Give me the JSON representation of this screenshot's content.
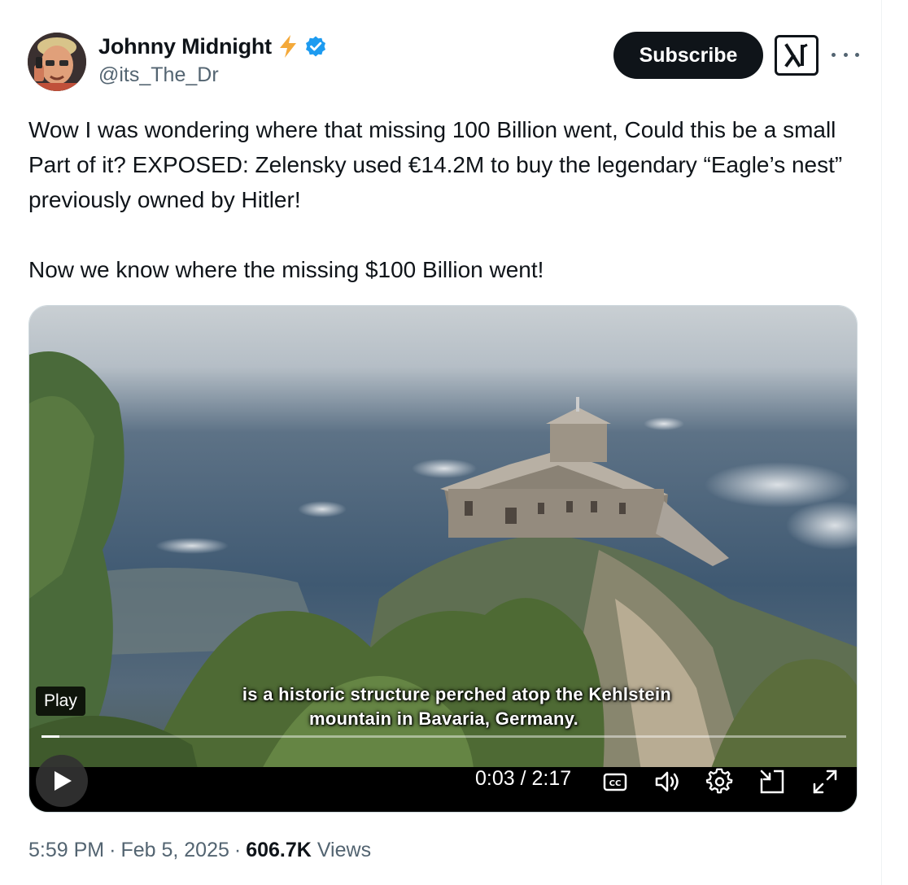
{
  "author": {
    "display_name": "Johnny Midnight",
    "handle": "@its_The_Dr",
    "badge_icons": [
      "lightning-bolt-icon",
      "verified-badge-icon"
    ],
    "badge_colors": {
      "bolt": "#f4a93a",
      "verified": "#1d9bf0"
    }
  },
  "actions": {
    "subscribe_label": "Subscribe",
    "grok_icon": "grok-icon",
    "more_icon": "more-dots-icon"
  },
  "tweet": {
    "paragraph_1": "Wow I was wondering where that missing 100 Billion went, Could this be a small Part of it? EXPOSED: Zelensky used €14.2M to buy the legendary “Eagle’s nest” previously owned by Hitler!",
    "paragraph_2": "Now we know where the missing $100 Billion went!"
  },
  "video": {
    "play_tooltip": "Play",
    "subtitle_line_1": "is a historic structure perched atop the Kehlstein",
    "subtitle_line_2": "mountain in Bavaria, Germany.",
    "current_time": "0:03",
    "duration": "2:17",
    "time_separator": " / ",
    "progress_fraction": 0.022,
    "control_icons": [
      "play-icon",
      "closed-captions-icon",
      "volume-icon",
      "settings-icon",
      "pop-out-icon",
      "fullscreen-icon"
    ]
  },
  "meta": {
    "time": "5:59 PM",
    "date": "Feb 5, 2025",
    "separator": "·",
    "views_count": "606.7K",
    "views_label": "Views"
  }
}
